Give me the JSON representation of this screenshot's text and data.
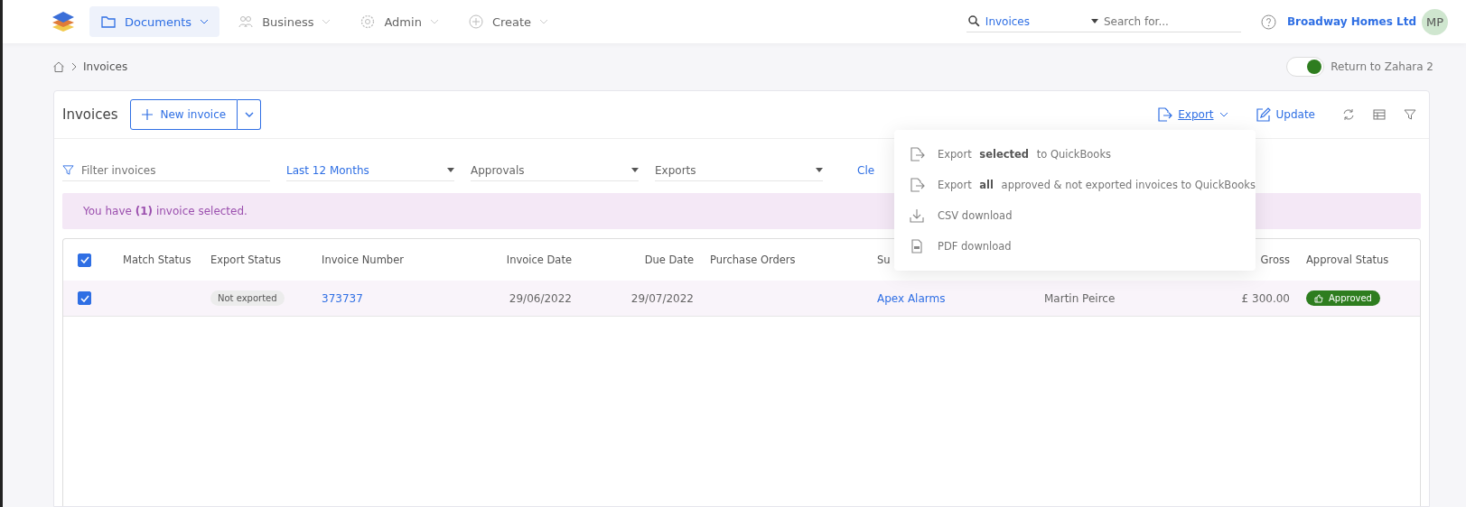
{
  "nav": {
    "items": [
      {
        "label": "Documents",
        "selected": true,
        "kind": "documents"
      },
      {
        "label": "Business",
        "selected": false,
        "kind": "business"
      },
      {
        "label": "Admin",
        "selected": false,
        "kind": "admin"
      },
      {
        "label": "Create",
        "selected": false,
        "kind": "create"
      }
    ],
    "search": {
      "scope": "Invoices",
      "placeholder": "Search for..."
    },
    "company": "Broadway Homes Ltd",
    "avatar": "MP"
  },
  "breadcrumb": {
    "current": "Invoices"
  },
  "toggle": {
    "label": "Return to Zahara 2",
    "on": true
  },
  "card": {
    "title": "Invoices",
    "new_button": "New invoice",
    "export": "Export",
    "update": "Update"
  },
  "filters": {
    "placeholder": "Filter invoices",
    "period": "Last 12 Months",
    "approvals": "Approvals",
    "exports": "Exports",
    "clear": "Cle"
  },
  "banner": "You have **(1)** invoice selected.",
  "export_menu": [
    {
      "kind": "export",
      "label": "Export **selected** to QuickBooks"
    },
    {
      "kind": "export",
      "label": "Export **all** approved & not exported invoices to QuickBooks"
    },
    {
      "kind": "csv",
      "label": "CSV download"
    },
    {
      "kind": "pdf",
      "label": "PDF download"
    }
  ],
  "table": {
    "all_checked": true,
    "columns": [
      "Match Status",
      "Export Status",
      "Invoice Number",
      "Invoice Date",
      "Due Date",
      "Purchase Orders",
      "Su",
      "Gross",
      "Approval Status"
    ],
    "rows": [
      {
        "checked": true,
        "selected": true,
        "export_status": "Not exported",
        "invoice_number": "373737",
        "invoice_date": "29/06/2022",
        "due_date": "29/07/2022",
        "supplier": "Apex Alarms",
        "column_8": "Martin Peirce",
        "gross": "£ 300.00",
        "approval_status": "Approved"
      }
    ]
  }
}
